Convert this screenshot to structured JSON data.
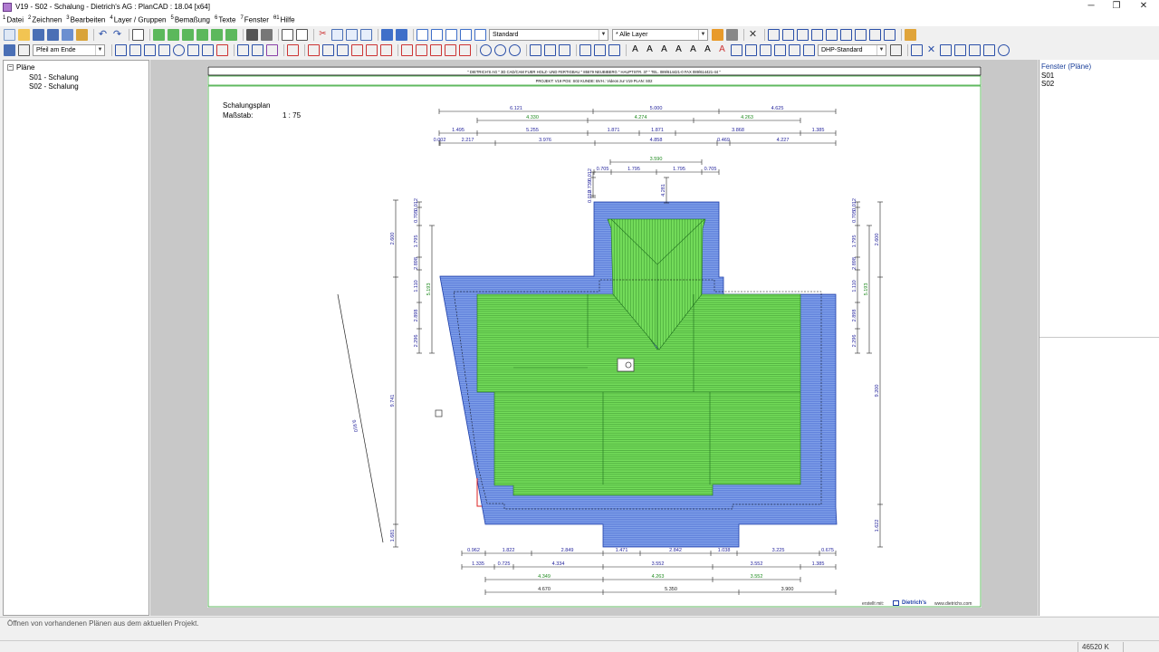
{
  "window": {
    "title": "V19 - S02 - Schalung - Dietrich's AG : PlanCAD : 18.04 [x64]",
    "minimize": "─",
    "maximize": "❐",
    "close": "✕"
  },
  "menu": [
    {
      "num": "1",
      "label": "Datei"
    },
    {
      "num": "2",
      "label": "Zeichnen"
    },
    {
      "num": "3",
      "label": "Bearbeiten"
    },
    {
      "num": "4",
      "label": "Layer / Gruppen"
    },
    {
      "num": "5",
      "label": "Bemaßung"
    },
    {
      "num": "6",
      "label": "Texte"
    },
    {
      "num": "7",
      "label": "Fenster"
    },
    {
      "num": "θ1",
      "label": "Hilfe"
    }
  ],
  "toolbar": {
    "style_combo": "Standard",
    "layer_combo": "* Alle Layer",
    "arrow_combo": "Pfeil am Ende",
    "dim_style_combo": "DHP-Standard"
  },
  "tree": {
    "root": "Pläne",
    "items": [
      "S01 - Schalung",
      "S02 - Schalung"
    ]
  },
  "window_list": {
    "title": "Fenster (Pläne)",
    "items": [
      "S01",
      "S02"
    ]
  },
  "drawing": {
    "header_line1": "\" DIETRICH'S AG \"  3D CAD/CAM FUER HOLZ- UND FERTIGBAU  \" 85579 NEUBIBERG \" HAUPTSTR. 37  \"  TEL. 089/614421-0   FAX 089/614421-44 \"",
    "header_line2": "PROJEKT: V19    POS: S02    KUNDE:    BVH.: Videos zur V19    PLAN: S02",
    "plan_title": "Schalungsplan",
    "scale_label": "Maßstab:",
    "scale_value": "1 : 75",
    "footer_created": "erstellt mit:",
    "footer_brand": "Dietrich's",
    "footer_url": "www.dietrichs.com",
    "dims_top_row1": [
      "6.121",
      "5.000",
      "4.625"
    ],
    "dims_top_row2": [
      "4.330",
      "4.274",
      "4.263"
    ],
    "dims_top_row3": [
      "1.495",
      "5.255",
      "1.871",
      "1.871",
      "3.868",
      "1.385"
    ],
    "dims_top_row4": [
      "0.002",
      "2.217",
      "3.976",
      "4.858",
      "0.469",
      "4.227"
    ],
    "dims_gable_green": [
      "3.590"
    ],
    "dims_gable_row": [
      "0.705",
      "1.795",
      "1.795",
      "0.705"
    ],
    "dims_gable_vert": [
      "0.012",
      "0.739",
      "4.281",
      "0.012"
    ],
    "dims_left_inner": [
      "0.012",
      "0.705",
      "1.795",
      "2.898",
      "1.110",
      "2.898",
      "2.296",
      "0.002"
    ],
    "dims_left_green": [
      "5.193"
    ],
    "dims_left_outer": [
      "2.600",
      "9.741",
      "1.681"
    ],
    "dims_slant": [
      "9.910"
    ],
    "dims_right_inner": [
      "0.012",
      "0.705",
      "1.795",
      "2.898",
      "1.110",
      "2.898",
      "2.296",
      "0.002"
    ],
    "dims_right_green": [
      "5.193"
    ],
    "dims_right_outer": [
      "2.600",
      "9.200",
      "1.622"
    ],
    "dims_bottom_row1": [
      "0.962",
      "1.822",
      "2.849",
      "1.471",
      "2.842",
      "1.038",
      "3.225",
      "0.675"
    ],
    "dims_bottom_row2": [
      "1.335",
      "0.725",
      "4.334",
      "3.552",
      "3.552",
      "1.385"
    ],
    "dims_bottom_row3": [
      "4.349",
      "4.263",
      "3.552"
    ],
    "dims_bottom_row4": [
      "4.670",
      "5.350",
      "3.900"
    ]
  },
  "status": {
    "message": "Öffnen von vorhandenen Plänen aus dem aktuellen Projekt.",
    "memory": "46520 K"
  },
  "colors": {
    "roof_blue": "#7f9fe8",
    "roof_green": "#74dd5b",
    "dim_blue": "#1f1f9a",
    "dim_green": "#1f8a1f",
    "frame_green": "#3aa83a"
  }
}
